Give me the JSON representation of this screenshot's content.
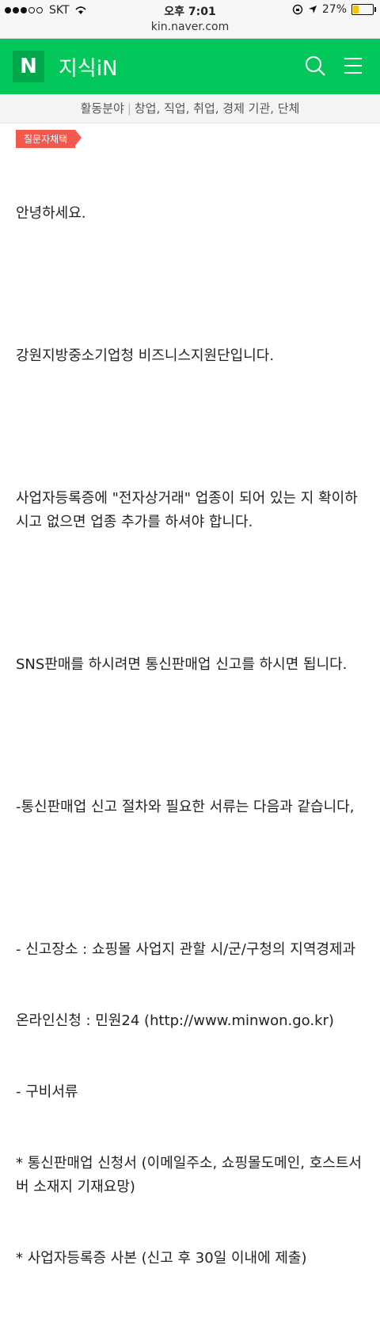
{
  "status": {
    "carrier": "SKT",
    "time": "오후 7:01",
    "battery": "27%",
    "battery_level": 0.27
  },
  "url": "kin.naver.com",
  "header": {
    "logo": "N",
    "title": "지식iN"
  },
  "subnav": {
    "items": [
      "활동분야",
      "창업, 직업, 취업, 경제 기관, 단체"
    ]
  },
  "badge": "질문자채택",
  "answer": {
    "lines": [
      "안녕하세요.",
      "",
      "강원지방중소기업청 비즈니스지원단입니다.",
      "",
      "사업자등록증에 \"전자상거래\" 업종이 되어 있는 지 확이하시고 없으면 업종 추가를 하셔야 합니다.",
      "",
      "SNS판매를 하시려면 통신판매업 신고를 하시면 됩니다.",
      "",
      "-통신판매업 신고 절차와 필요한 서류는 다음과 같습니다,",
      "",
      "- 신고장소 : 쇼핑몰 사업지 관할 시/군/구청의 지역경제과",
      "온라인신청 : 민원24 (http://www.minwon.go.kr)",
      "- 구비서류",
      "* 통신판매업 신청서 (이메일주소, 쇼핑몰도메인, 호스트서버 소재지 기재요망)",
      "* 사업자등록증 사본 (신고 후 30일 이내에 제출)"
    ]
  },
  "icons": {
    "search": "search-icon",
    "menu": "menu-icon"
  }
}
